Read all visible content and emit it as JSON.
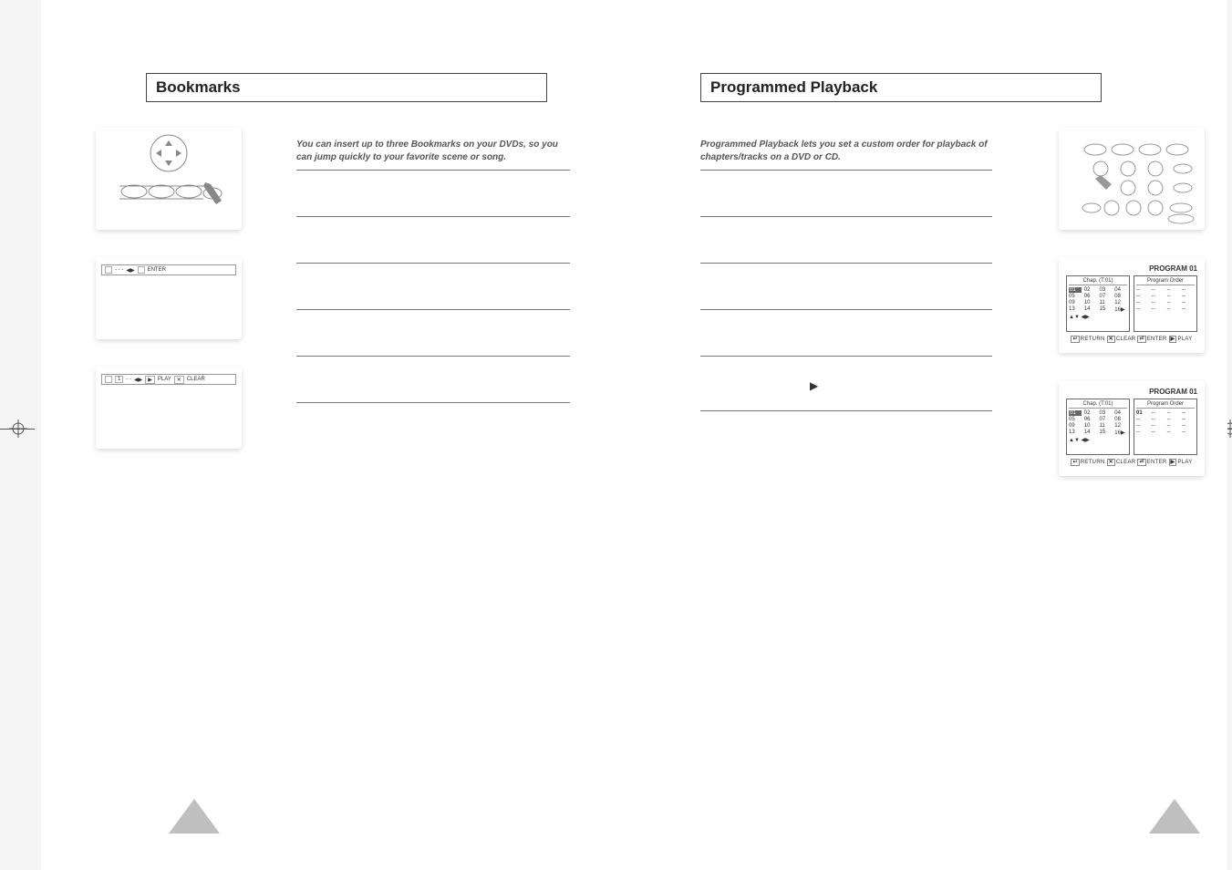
{
  "left": {
    "title": "Bookmarks",
    "intro": "You can insert up to three Bookmarks on your DVDs, so you can jump quickly to your favorite scene or song.",
    "osd1": {
      "slots": "- - -",
      "arrows": "◀▶",
      "enter": "ENTER"
    },
    "osd2": {
      "first": "1",
      "slots": "- -",
      "arrows": "◀▶",
      "play": "PLAY",
      "clear": "CLEAR"
    }
  },
  "right": {
    "title": "Programmed Playback",
    "intro": "Programmed Playback lets you set a custom order for playback of chapters/tracks on a DVD or CD.",
    "play_symbol": "▶",
    "program1": {
      "heading": "PROGRAM 01",
      "left_hdr": "Chap. (T:01)",
      "right_hdr": "Program Order",
      "chapters": [
        "01",
        "02",
        "03",
        "04",
        "05",
        "06",
        "07",
        "08",
        "09",
        "10",
        "11",
        "12",
        "13",
        "14",
        "15",
        "16"
      ],
      "more": "▶",
      "order": [
        "--",
        "--",
        "--",
        "--",
        "--",
        "--",
        "--",
        "--",
        "--",
        "--",
        "--",
        "--",
        "--",
        "--",
        "--",
        "--"
      ],
      "nav": "▲▼ ◀▶",
      "footer": {
        "return": "RETURN",
        "clear": "CLEAR",
        "enter": "ENTER",
        "play": "PLAY"
      }
    },
    "program2": {
      "heading": "PROGRAM 01",
      "left_hdr": "Chap. (T:01)",
      "right_hdr": "Program Order",
      "chapters": [
        "01",
        "02",
        "03",
        "04",
        "05",
        "06",
        "07",
        "08",
        "09",
        "10",
        "11",
        "12",
        "13",
        "14",
        "15",
        "16"
      ],
      "more": "▶",
      "order": [
        "01",
        "--",
        "--",
        "--",
        "--",
        "--",
        "--",
        "--",
        "--",
        "--",
        "--",
        "--",
        "--",
        "--",
        "--",
        "--"
      ],
      "nav": "▲▼ ◀▶",
      "footer": {
        "return": "RETURN",
        "clear": "CLEAR",
        "enter": "ENTER",
        "play": "PLAY"
      }
    }
  }
}
